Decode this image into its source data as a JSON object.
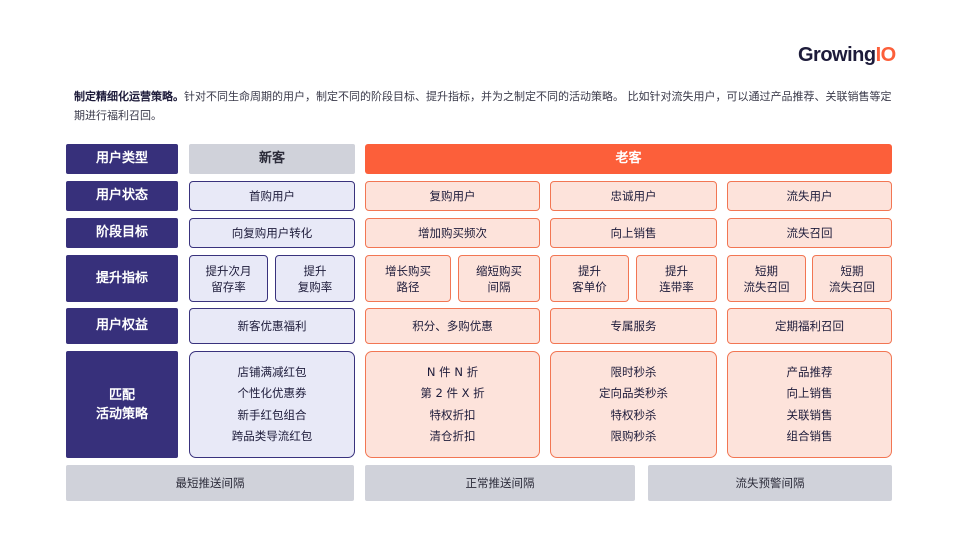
{
  "logo": {
    "main": "Growing",
    "accent": "IO"
  },
  "intro": {
    "lead": "制定精细化运营策略。",
    "rest": "针对不同生命周期的用户，制定不同的阶段目标、提升指标，并为之制定不同的活动策略。 比如针对流失用户，可以通过产品推荐、关联销售等定期进行福利召回。"
  },
  "row_headers": {
    "user_type": "用户类型",
    "user_status": "用户状态",
    "stage_goal": "阶段目标",
    "metrics": "提升指标",
    "benefits": "用户权益",
    "strategy": "匹配\n活动策略"
  },
  "user_type": {
    "new": "新客",
    "old": "老客"
  },
  "user_status": {
    "first": "首购用户",
    "repeat": "复购用户",
    "loyal": "忠诚用户",
    "lost": "流失用户"
  },
  "stage_goal": {
    "new": "向复购用户转化",
    "repeat": "增加购买频次",
    "loyal": "向上销售",
    "lost": "流失召回"
  },
  "metrics": {
    "new_1": "提升次月\n留存率",
    "new_2": "提升\n复购率",
    "repeat_1": "增长购买\n路径",
    "repeat_2": "缩短购买\n间隔",
    "loyal_1": "提升\n客单价",
    "loyal_2": "提升\n连带率",
    "lost_1": "短期\n流失召回",
    "lost_2": "短期\n流失召回"
  },
  "benefits": {
    "new": "新客优惠福利",
    "repeat": "积分、多购优惠",
    "loyal": "专属服务",
    "lost": "定期福利召回"
  },
  "strategy": {
    "new": [
      "店铺满减红包",
      "个性化优惠券",
      "新手红包组合",
      "跨品类导流红包"
    ],
    "repeat": [
      "N 件 N 折",
      "第 2 件 X 折",
      "特权折扣",
      "清仓折扣"
    ],
    "loyal": [
      "限时秒杀",
      "定向品类秒杀",
      "特权秒杀",
      "限购秒杀"
    ],
    "lost": [
      "产品推荐",
      "向上销售",
      "关联销售",
      "组合销售"
    ]
  },
  "footer": {
    "shortest": "最短推送间隔",
    "normal": "正常推送间隔",
    "warning": "流失预警间隔"
  },
  "colors": {
    "navy": "#37307b",
    "orange": "#fc5f3a",
    "gray": "#d0d2da",
    "new_fill": "#e8e9f7",
    "old_fill": "#fde3db"
  }
}
